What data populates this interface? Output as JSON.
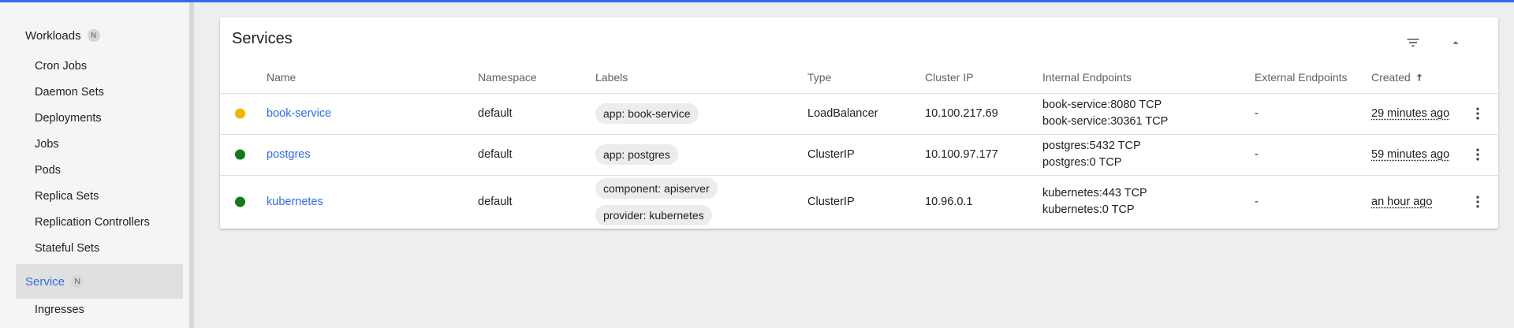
{
  "sidebar": {
    "header": {
      "label": "Workloads",
      "badge": "N"
    },
    "items": [
      {
        "label": "Cron Jobs"
      },
      {
        "label": "Daemon Sets"
      },
      {
        "label": "Deployments"
      },
      {
        "label": "Jobs"
      },
      {
        "label": "Pods"
      },
      {
        "label": "Replica Sets"
      },
      {
        "label": "Replication Controllers"
      },
      {
        "label": "Stateful Sets"
      }
    ],
    "active": {
      "label": "Service",
      "badge": "N"
    },
    "after_items": [
      {
        "label": "Ingresses"
      }
    ]
  },
  "card": {
    "title": "Services",
    "columns": {
      "name": "Name",
      "namespace": "Namespace",
      "labels": "Labels",
      "type": "Type",
      "cluster_ip": "Cluster IP",
      "internal_endpoints": "Internal Endpoints",
      "external_endpoints": "External Endpoints",
      "created": "Created"
    },
    "rows": [
      {
        "status": "pending",
        "status_color": "#f4b400",
        "name": "book-service",
        "namespace": "default",
        "labels": [
          "app: book-service"
        ],
        "type": "LoadBalancer",
        "cluster_ip": "10.100.217.69",
        "internal_endpoints": [
          "book-service:8080 TCP",
          "book-service:30361 TCP"
        ],
        "external_endpoints": "-",
        "created": "29 minutes ago"
      },
      {
        "status": "ok",
        "status_color": "#0f7c15",
        "name": "postgres",
        "namespace": "default",
        "labels": [
          "app: postgres"
        ],
        "type": "ClusterIP",
        "cluster_ip": "10.100.97.177",
        "internal_endpoints": [
          "postgres:5432 TCP",
          "postgres:0 TCP"
        ],
        "external_endpoints": "-",
        "created": "59 minutes ago"
      },
      {
        "status": "ok",
        "status_color": "#0f7c15",
        "name": "kubernetes",
        "namespace": "default",
        "labels": [
          "component: apiserver",
          "provider: kubernetes"
        ],
        "type": "ClusterIP",
        "cluster_ip": "10.96.0.1",
        "internal_endpoints": [
          "kubernetes:443 TCP",
          "kubernetes:0 TCP"
        ],
        "external_endpoints": "-",
        "created": "an hour ago"
      }
    ]
  },
  "colors": {
    "accent": "#326de6",
    "link": "#326de6"
  }
}
